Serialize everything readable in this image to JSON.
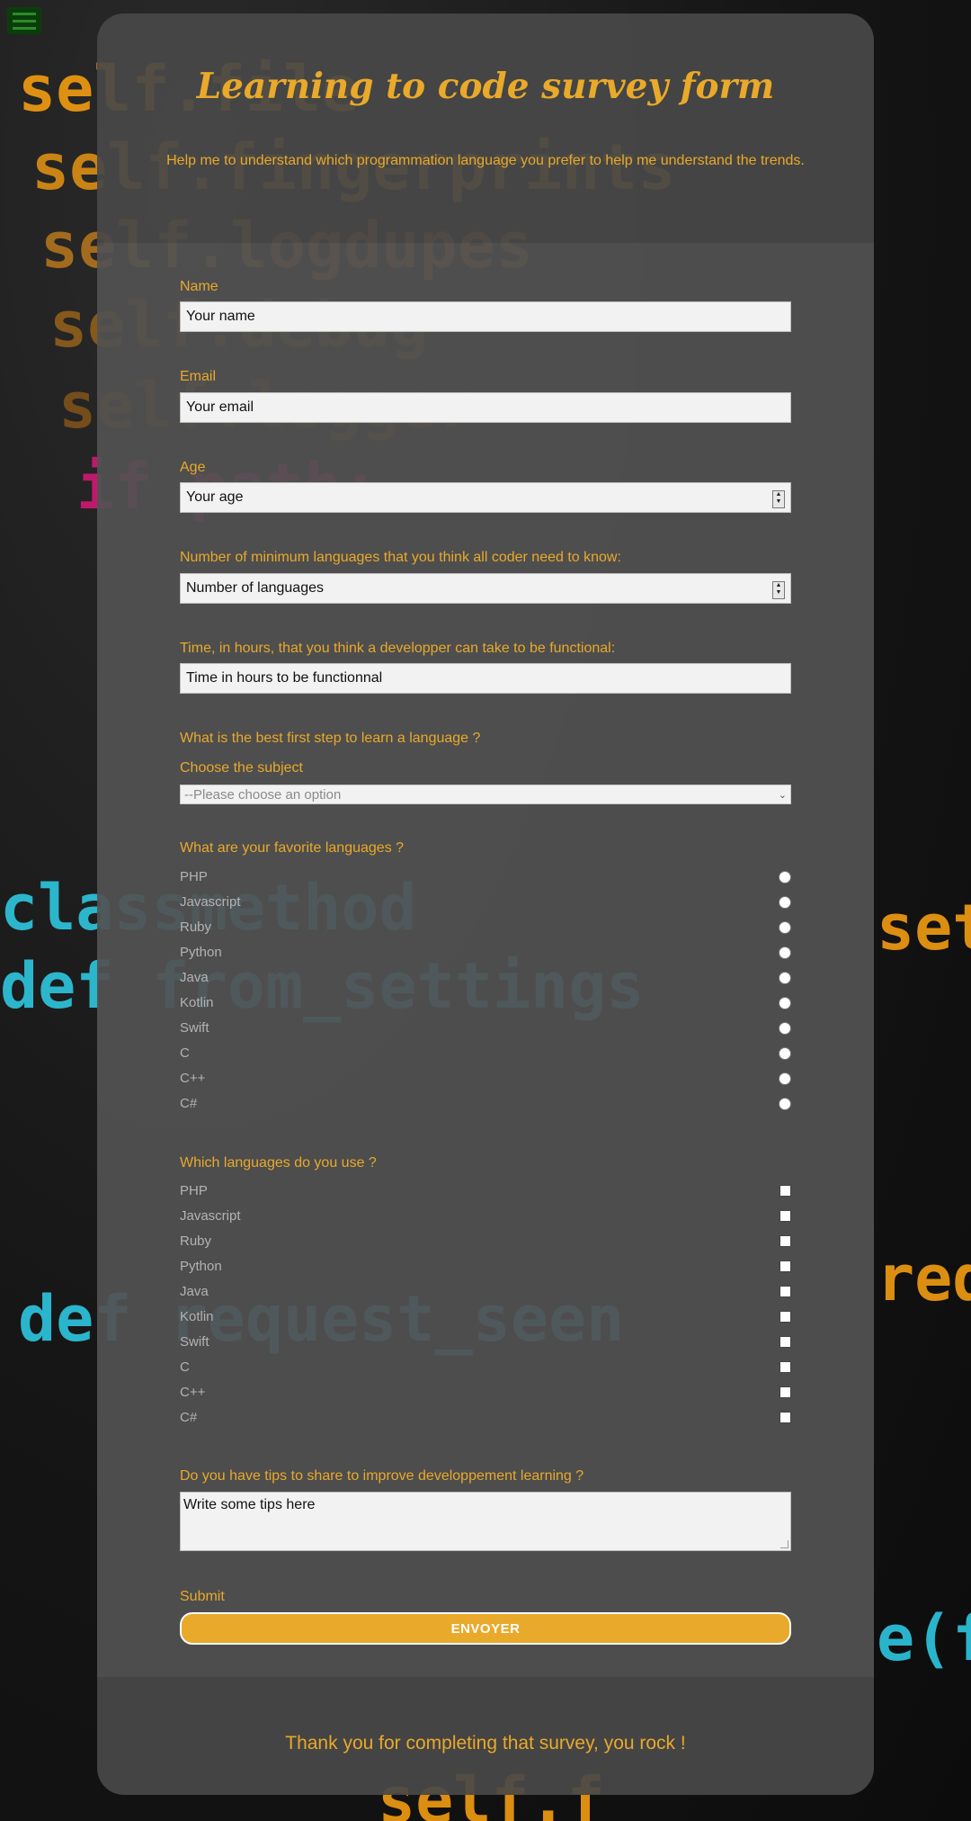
{
  "page": {
    "title": "Learning to code survey form",
    "subtitle": "Help me to understand which programmation language you prefer to help me understand the trends.",
    "thanks": "Thank you for completing that survey, you rock !"
  },
  "colors": {
    "accent": "#e9a92a",
    "card": "#525252",
    "option_text": "#b3b3b3"
  },
  "menu": {
    "icon": "hamburger-menu-icon"
  },
  "form": {
    "name": {
      "label": "Name",
      "placeholder": "Your name"
    },
    "email": {
      "label": "Email",
      "placeholder": "Your email"
    },
    "age": {
      "label": "Age",
      "placeholder": "Your age"
    },
    "languages_count": {
      "label": "Number of minimum languages that you think all coder need to know:",
      "placeholder": "Number of languages"
    },
    "hours": {
      "label": "Time, in hours, that you think a developper can take to be functional:",
      "placeholder": "Time in hours to be functionnal"
    },
    "first_step": {
      "question": "What is the best first step to learn a language ?",
      "label": "Choose the subject",
      "selected": "--Please choose an option"
    },
    "favorite": {
      "question": "What are your favorite languages ?",
      "options": [
        "PHP",
        "Javascript",
        "Ruby",
        "Python",
        "Java",
        "Kotlin",
        "Swift",
        "C",
        "C++",
        "C#"
      ]
    },
    "use": {
      "question": "Which languages do you use ?",
      "options": [
        "PHP",
        "Javascript",
        "Ruby",
        "Python",
        "Java",
        "Kotlin",
        "Swift",
        "C",
        "C++",
        "C#"
      ]
    },
    "tips": {
      "label": "Do you have tips to share to improve developpement learning ?",
      "placeholder": "Write some tips here"
    },
    "submit": {
      "label": "Submit",
      "button": "ENVOYER"
    }
  }
}
